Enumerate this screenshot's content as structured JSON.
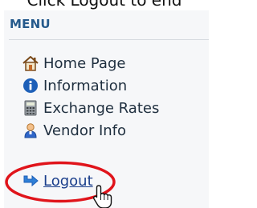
{
  "caption": "Click Logout to end",
  "menu": {
    "header": "MENU",
    "items": [
      {
        "label": "Home Page",
        "icon": "home-icon"
      },
      {
        "label": "Information",
        "icon": "info-icon"
      },
      {
        "label": "Exchange Rates",
        "icon": "calculator-icon"
      },
      {
        "label": "Vendor Info",
        "icon": "user-icon"
      },
      {
        "label": "Logout",
        "icon": "logout-arrow-icon"
      }
    ]
  },
  "colors": {
    "header": "#255a8c",
    "link": "#1b3f8c",
    "highlight": "#e0141b"
  }
}
